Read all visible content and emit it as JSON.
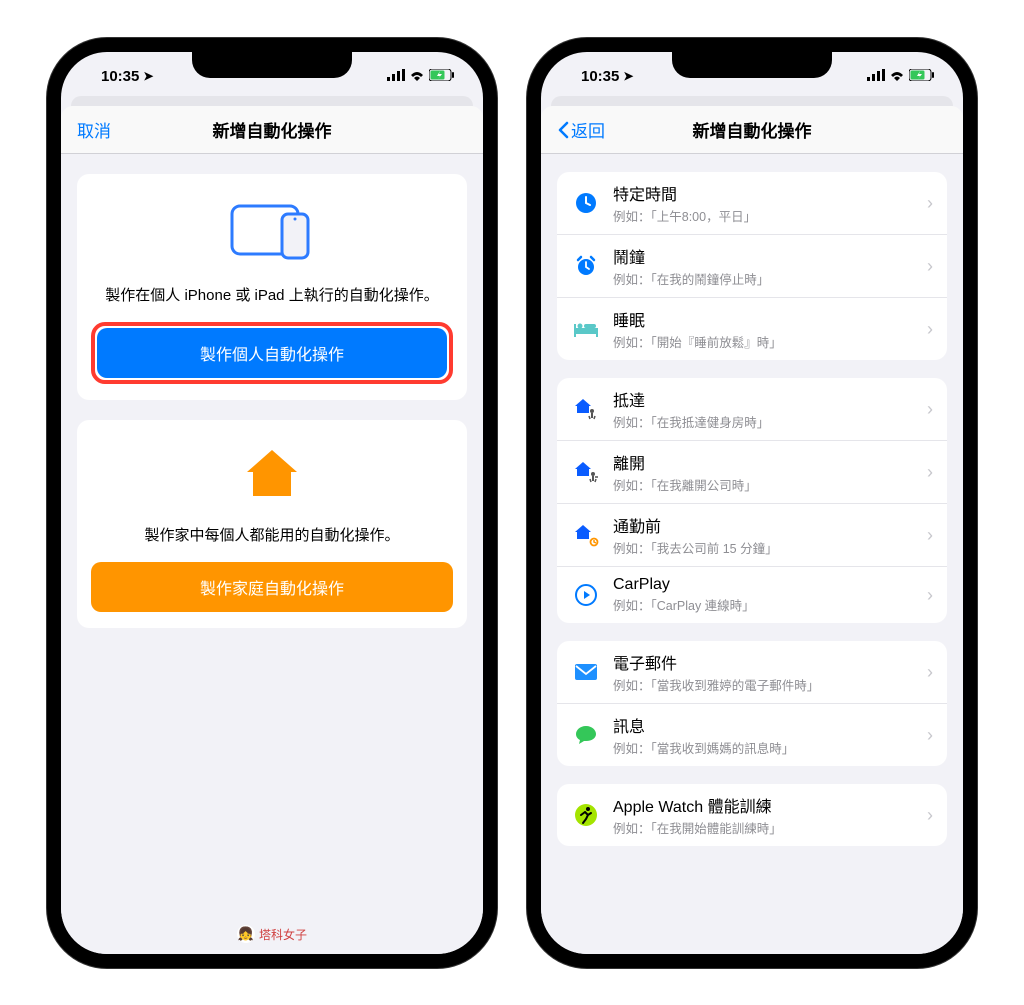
{
  "statusbar": {
    "time": "10:35"
  },
  "left_phone": {
    "nav": {
      "cancel": "取消",
      "title": "新增自動化操作"
    },
    "card1": {
      "desc": "製作在個人 iPhone 或 iPad 上執行的自動化操作。",
      "button": "製作個人自動化操作"
    },
    "card2": {
      "desc": "製作家中每個人都能用的自動化操作。",
      "button": "製作家庭自動化操作"
    }
  },
  "right_phone": {
    "nav": {
      "back": "返回",
      "title": "新增自動化操作"
    },
    "groups": [
      [
        {
          "icon": "clock",
          "color": "#007aff",
          "title": "特定時間",
          "sub": "例如：「上午8:00，平日」"
        },
        {
          "icon": "alarm",
          "color": "#007aff",
          "title": "鬧鐘",
          "sub": "例如：「在我的鬧鐘停止時」"
        },
        {
          "icon": "bed",
          "color": "#5ac8c8",
          "title": "睡眠",
          "sub": "例如：「開始『睡前放鬆』時」"
        }
      ],
      [
        {
          "icon": "home-arrive",
          "color": "#0a5cff",
          "title": "抵達",
          "sub": "例如：「在我抵達健身房時」"
        },
        {
          "icon": "home-leave",
          "color": "#0a5cff",
          "title": "離開",
          "sub": "例如：「在我離開公司時」"
        },
        {
          "icon": "commute",
          "color": "#0a5cff",
          "title": "通勤前",
          "sub": "例如：「我去公司前 15 分鐘」"
        },
        {
          "icon": "carplay",
          "color": "#007aff",
          "title": "CarPlay",
          "sub": "例如：「CarPlay 連線時」"
        }
      ],
      [
        {
          "icon": "mail",
          "color": "#1e90ff",
          "title": "電子郵件",
          "sub": "例如：「當我收到雅婷的電子郵件時」"
        },
        {
          "icon": "message",
          "color": "#34c759",
          "title": "訊息",
          "sub": "例如：「當我收到媽媽的訊息時」"
        }
      ],
      [
        {
          "icon": "workout",
          "color": "#a4e400",
          "title": "Apple Watch 體能訓練",
          "sub": "例如：「在我開始體能訓練時」"
        }
      ]
    ]
  },
  "watermark": "塔科女子"
}
